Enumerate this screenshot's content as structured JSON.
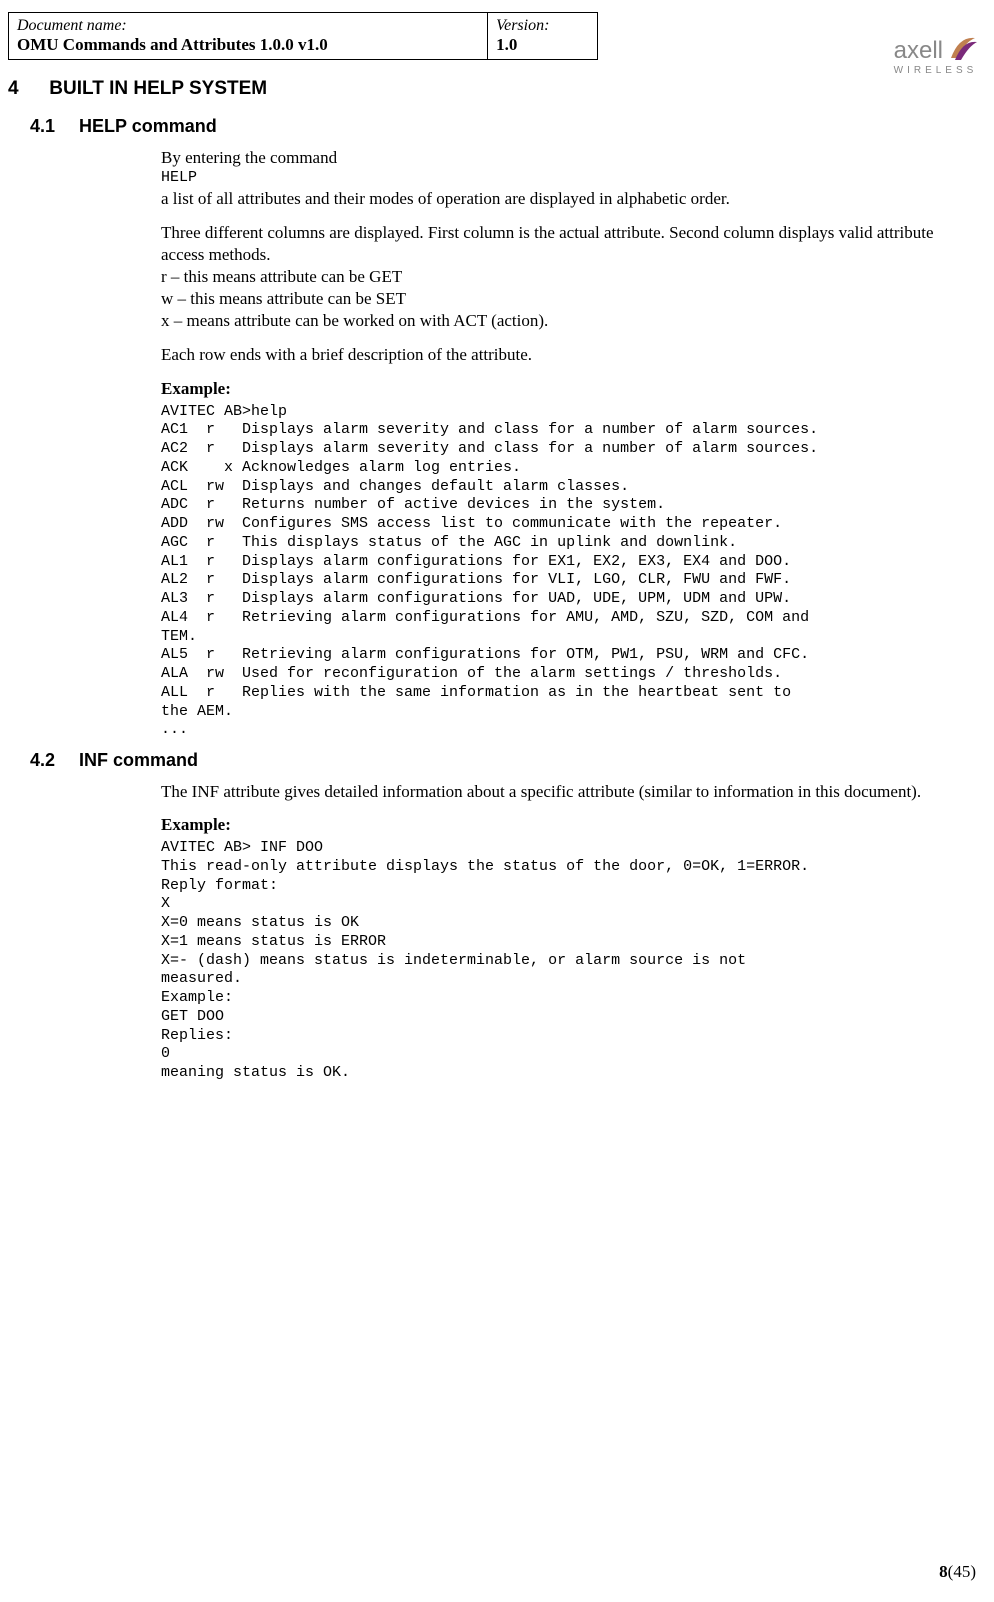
{
  "header": {
    "docname_label": "Document name:",
    "docname_value": "OMU Commands and Attributes 1.0.0 v1.0",
    "version_label": "Version:",
    "version_value": "1.0"
  },
  "logo": {
    "brand": "axell",
    "sub": "WIRELESS"
  },
  "section4": {
    "num": "4",
    "title": "BUILT IN HELP SYSTEM"
  },
  "section41": {
    "num": "4.1",
    "title": "HELP command",
    "p1": "By entering the command",
    "cmd": "HELP",
    "p2": "a list of all attributes and their modes of operation are displayed in alphabetic order.",
    "p3": "Three different columns are displayed. First column is the actual attribute. Second column displays valid attribute access methods.",
    "p4": "r – this means attribute can be GET",
    "p5": "w – this means attribute can be SET",
    "p6": "x – means attribute can be worked on with ACT (action).",
    "p7": "Each row ends with a brief description of the attribute.",
    "example_label": "Example:",
    "example": "AVITEC AB>help\nAC1  r   Displays alarm severity and class for a number of alarm sources.\nAC2  r   Displays alarm severity and class for a number of alarm sources.\nACK    x Acknowledges alarm log entries.\nACL  rw  Displays and changes default alarm classes.\nADC  r   Returns number of active devices in the system.\nADD  rw  Configures SMS access list to communicate with the repeater.\nAGC  r   This displays status of the AGC in uplink and downlink.\nAL1  r   Displays alarm configurations for EX1, EX2, EX3, EX4 and DOO.\nAL2  r   Displays alarm configurations for VLI, LGO, CLR, FWU and FWF.\nAL3  r   Displays alarm configurations for UAD, UDE, UPM, UDM and UPW.\nAL4  r   Retrieving alarm configurations for AMU, AMD, SZU, SZD, COM and\nTEM.\nAL5  r   Retrieving alarm configurations for OTM, PW1, PSU, WRM and CFC.\nALA  rw  Used for reconfiguration of the alarm settings / thresholds.\nALL  r   Replies with the same information as in the heartbeat sent to\nthe AEM.\n..."
  },
  "section42": {
    "num": "4.2",
    "title": "INF command",
    "p1": "The INF attribute gives detailed information about a specific attribute (similar to information in this document).",
    "example_label": "Example:",
    "example": "AVITEC AB> INF DOO\nThis read-only attribute displays the status of the door, 0=OK, 1=ERROR.\nReply format:\nX\nX=0 means status is OK\nX=1 means status is ERROR\nX=- (dash) means status is indeterminable, or alarm source is not\nmeasured.\nExample:\nGET DOO\nReplies:\n0\nmeaning status is OK."
  },
  "footer": {
    "page": "8",
    "total": "(45)"
  }
}
